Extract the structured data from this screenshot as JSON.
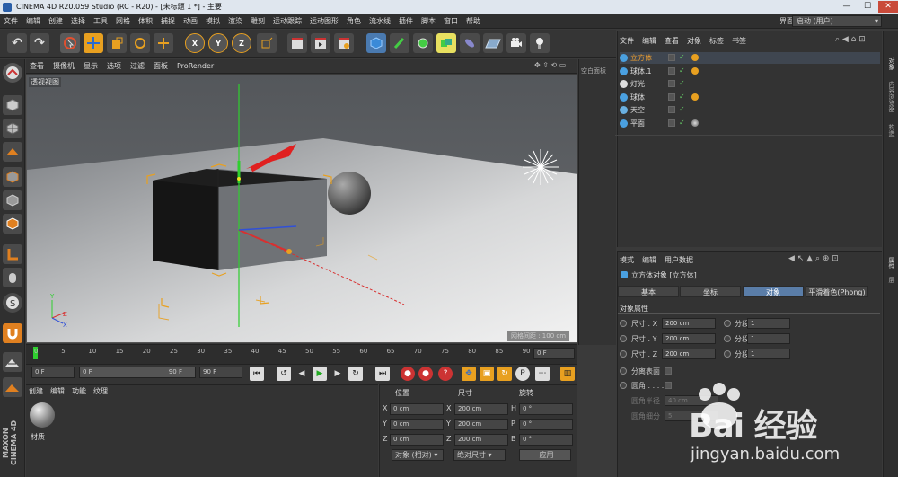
{
  "window": {
    "title": "CINEMA 4D R20.059 Studio (RC - R20) - [未标题 1 *] - 主要",
    "min": "—",
    "max": "☐",
    "close": "✕"
  },
  "menubar": {
    "items": [
      "文件",
      "编辑",
      "创建",
      "选择",
      "工具",
      "网格",
      "体积",
      "捕捉",
      "动画",
      "模拟",
      "渲染",
      "雕刻",
      "运动跟踪",
      "运动图形",
      "角色",
      "流水线",
      "插件",
      "脚本",
      "窗口",
      "帮助"
    ],
    "layout_label": "界面:",
    "layout_value": "启动 (用户)"
  },
  "toolbar": {
    "undo": "↶",
    "redo": "↷",
    "x_axis": "X",
    "y_axis": "Y",
    "z_axis": "Z"
  },
  "viewport": {
    "menu": [
      "查看",
      "摄像机",
      "显示",
      "选项",
      "过滤",
      "面板",
      "ProRender"
    ],
    "label": "透视视图",
    "grid_spacing": "网格间距 : 100 cm",
    "side_label": "空白面板"
  },
  "timeline": {
    "ticks": [
      "0",
      "5",
      "10",
      "15",
      "20",
      "25",
      "30",
      "35",
      "40",
      "45",
      "50",
      "55",
      "60",
      "65",
      "70",
      "75",
      "80",
      "85",
      "90"
    ],
    "current_frame": "0 F"
  },
  "playback": {
    "start": "0 F",
    "range_start": "0 F",
    "range_end": "90 F",
    "end": "90 F"
  },
  "material": {
    "menu": [
      "创建",
      "编辑",
      "功能",
      "纹理"
    ],
    "item_label": "材质"
  },
  "coords": {
    "headers": [
      "位置",
      "尺寸",
      "旋转"
    ],
    "rows": [
      {
        "axis": "X",
        "pos": "0 cm",
        "size_axis": "X",
        "size": "200 cm",
        "rot_axis": "H",
        "rot": "0 °"
      },
      {
        "axis": "Y",
        "pos": "0 cm",
        "size_axis": "Y",
        "size": "200 cm",
        "rot_axis": "P",
        "rot": "0 °"
      },
      {
        "axis": "Z",
        "pos": "0 cm",
        "size_axis": "Z",
        "size": "200 cm",
        "rot_axis": "B",
        "rot": "0 °"
      }
    ],
    "mode": "对象 (相对)",
    "size_mode": "绝对尺寸",
    "apply": "应用"
  },
  "objects": {
    "menu": [
      "文件",
      "编辑",
      "查看",
      "对象",
      "标签",
      "书签"
    ],
    "rows": [
      {
        "name": "立方体",
        "color": "#4aa0e0",
        "selected": true
      },
      {
        "name": "球体.1",
        "color": "#4aa0e0",
        "selected": false
      },
      {
        "name": "灯光",
        "color": "#dddddd",
        "selected": false
      },
      {
        "name": "球体",
        "color": "#4aa0e0",
        "selected": false
      },
      {
        "name": "天空",
        "color": "#6ab0e0",
        "selected": false
      },
      {
        "name": "平面",
        "color": "#4aa0e0",
        "selected": false
      }
    ]
  },
  "attributes": {
    "menu": [
      "模式",
      "编辑",
      "用户数据"
    ],
    "object_title": "立方体对象 [立方体]",
    "tabs": [
      "基本",
      "坐标",
      "对象",
      "平滑着色(Phong)"
    ],
    "active_tab": "对象",
    "section": "对象属性",
    "size_rows": [
      {
        "label": "尺寸 . X",
        "value": "200 cm",
        "seg_label": "分段 X",
        "seg": "1"
      },
      {
        "label": "尺寸 . Y",
        "value": "200 cm",
        "seg_label": "分段 Y",
        "seg": "1"
      },
      {
        "label": "尺寸 . Z",
        "value": "200 cm",
        "seg_label": "分段 Z",
        "seg": "1"
      }
    ],
    "separate_surfaces": "分离表面",
    "fillet": "圆角 . . . .",
    "fillet_radius_label": "圆角半径",
    "fillet_radius": "40 cm",
    "fillet_subdiv_label": "圆角细分",
    "fillet_subdiv": "5"
  },
  "right_tabs": [
    "对象",
    "内容浏览器",
    "构造"
  ],
  "right_tabs2": [
    "属性",
    "层"
  ],
  "brand": "MAXON CINEMA 4D",
  "watermark": {
    "text": "Bai 经验",
    "url": "jingyan.baidu.com"
  },
  "colors": {
    "accent_blue": "#5a7da8",
    "orange": "#e07a20",
    "green_axis": "#2fcf2f",
    "red_axis": "#d83030"
  }
}
